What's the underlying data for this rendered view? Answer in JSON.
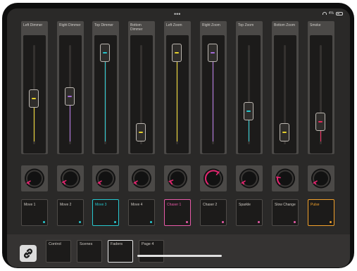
{
  "status": {
    "dots": "•••",
    "battery": "4%"
  },
  "faders": [
    {
      "label": "Left Dimmer",
      "color": "#e7d12b",
      "level": 0.45
    },
    {
      "label": "Right Dimmer",
      "color": "#a46ad8",
      "level": 0.48
    },
    {
      "label": "Top Dimmer",
      "color": "#27c8cf",
      "level": 1.0
    },
    {
      "label": "Bottom Dimmer",
      "color": "#e7d12b",
      "level": 0.05
    },
    {
      "label": "Left Zoom",
      "color": "#e7d12b",
      "level": 1.0
    },
    {
      "label": "Right Zoom",
      "color": "#a46ad8",
      "level": 1.0
    },
    {
      "label": "Top Zoom",
      "color": "#27c8cf",
      "level": 0.3
    },
    {
      "label": "Bottom Zoom",
      "color": "#e7d12b",
      "level": 0.05
    },
    {
      "label": "Smoke",
      "color": "#e8285b",
      "level": 0.18
    }
  ],
  "knobs": [
    {
      "value": 0.05
    },
    {
      "value": 0.07
    },
    {
      "value": 0.05
    },
    {
      "value": 0.05
    },
    {
      "value": 0.09
    },
    {
      "value": 0.65
    },
    {
      "value": 0.05
    },
    {
      "value": 0.2
    },
    {
      "value": 0.05
    }
  ],
  "knob_color": "#e3256f",
  "pads": [
    {
      "label": "Move 1",
      "border": "#4e4b48",
      "dot": "#27c8cf",
      "text": "#cfcac4"
    },
    {
      "label": "Move 2",
      "border": "#4e4b48",
      "dot": "#27c8cf",
      "text": "#cfcac4"
    },
    {
      "label": "Move 3",
      "border": "#27c8cf",
      "dot": "#27c8cf",
      "text": "#27c8cf"
    },
    {
      "label": "Move 4",
      "border": "#4e4b48",
      "dot": "#27c8cf",
      "text": "#cfcac4"
    },
    {
      "label": "Chaser 1",
      "border": "#e85aa8",
      "dot": "#e85aa8",
      "text": "#e85aa8"
    },
    {
      "label": "Chaser 2",
      "border": "#4e4b48",
      "dot": "#e85aa8",
      "text": "#cfcac4"
    },
    {
      "label": "Sparkle",
      "border": "#4e4b48",
      "dot": "#e85aa8",
      "text": "#cfcac4"
    },
    {
      "label": "Slow Change",
      "border": "#4e4b48",
      "dot": "#e85aa8",
      "text": "#cfcac4"
    },
    {
      "label": "Pulse",
      "border": "#f2a12b",
      "dot": "#f2a12b",
      "text": "#f2a12b"
    }
  ],
  "tabs": [
    {
      "label": "Control",
      "active": false
    },
    {
      "label": "Scenes",
      "active": false
    },
    {
      "label": "Faders",
      "active": true
    },
    {
      "label": "Page 4",
      "active": false
    }
  ]
}
